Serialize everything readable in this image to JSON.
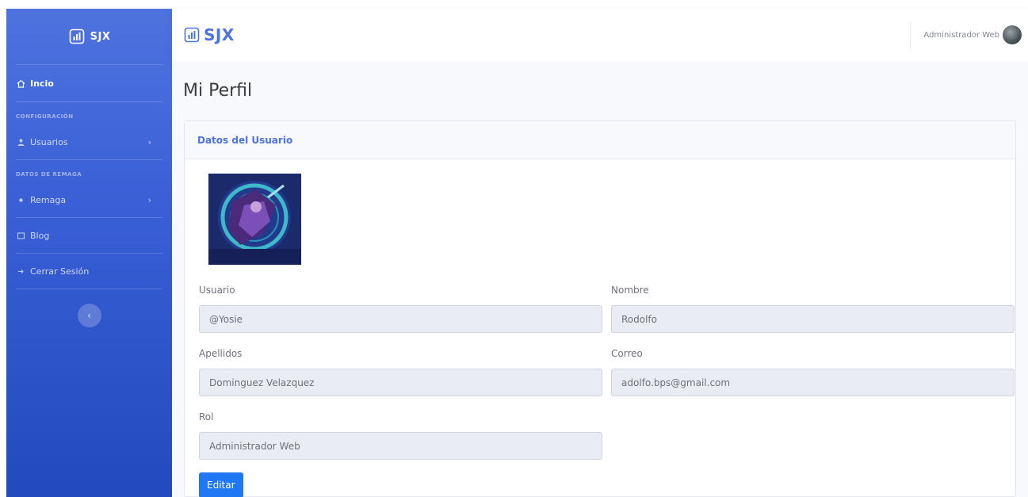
{
  "sidebar": {
    "brand": "SJX",
    "items": [
      {
        "label": "Incio"
      },
      {
        "label": "Usuarios"
      },
      {
        "label": "Remaga"
      },
      {
        "label": "Blog"
      },
      {
        "label": "Cerrar Sesión"
      }
    ],
    "headings": [
      "CONFIGURACIÓN",
      "DATOS DE REMAGA"
    ]
  },
  "topbar": {
    "brand": "SJX",
    "user_name": "Administrador Web"
  },
  "page": {
    "title": "Mi Perfil"
  },
  "card": {
    "title": "Datos del Usuario",
    "fields": {
      "usuario": {
        "label": "Usuario",
        "value": "@Yosie"
      },
      "nombre": {
        "label": "Nombre",
        "value": "Rodolfo"
      },
      "apellidos": {
        "label": "Apellidos",
        "value": "Dominguez Velazquez"
      },
      "correo": {
        "label": "Correo",
        "value": "adolfo.bps@gmail.com"
      },
      "rol": {
        "label": "Rol",
        "value": "Administrador Web"
      }
    },
    "edit_button": "Editar"
  },
  "colors": {
    "primary": "#4e73df",
    "button": "#1f77f3",
    "input_bg": "#eaecf4"
  }
}
